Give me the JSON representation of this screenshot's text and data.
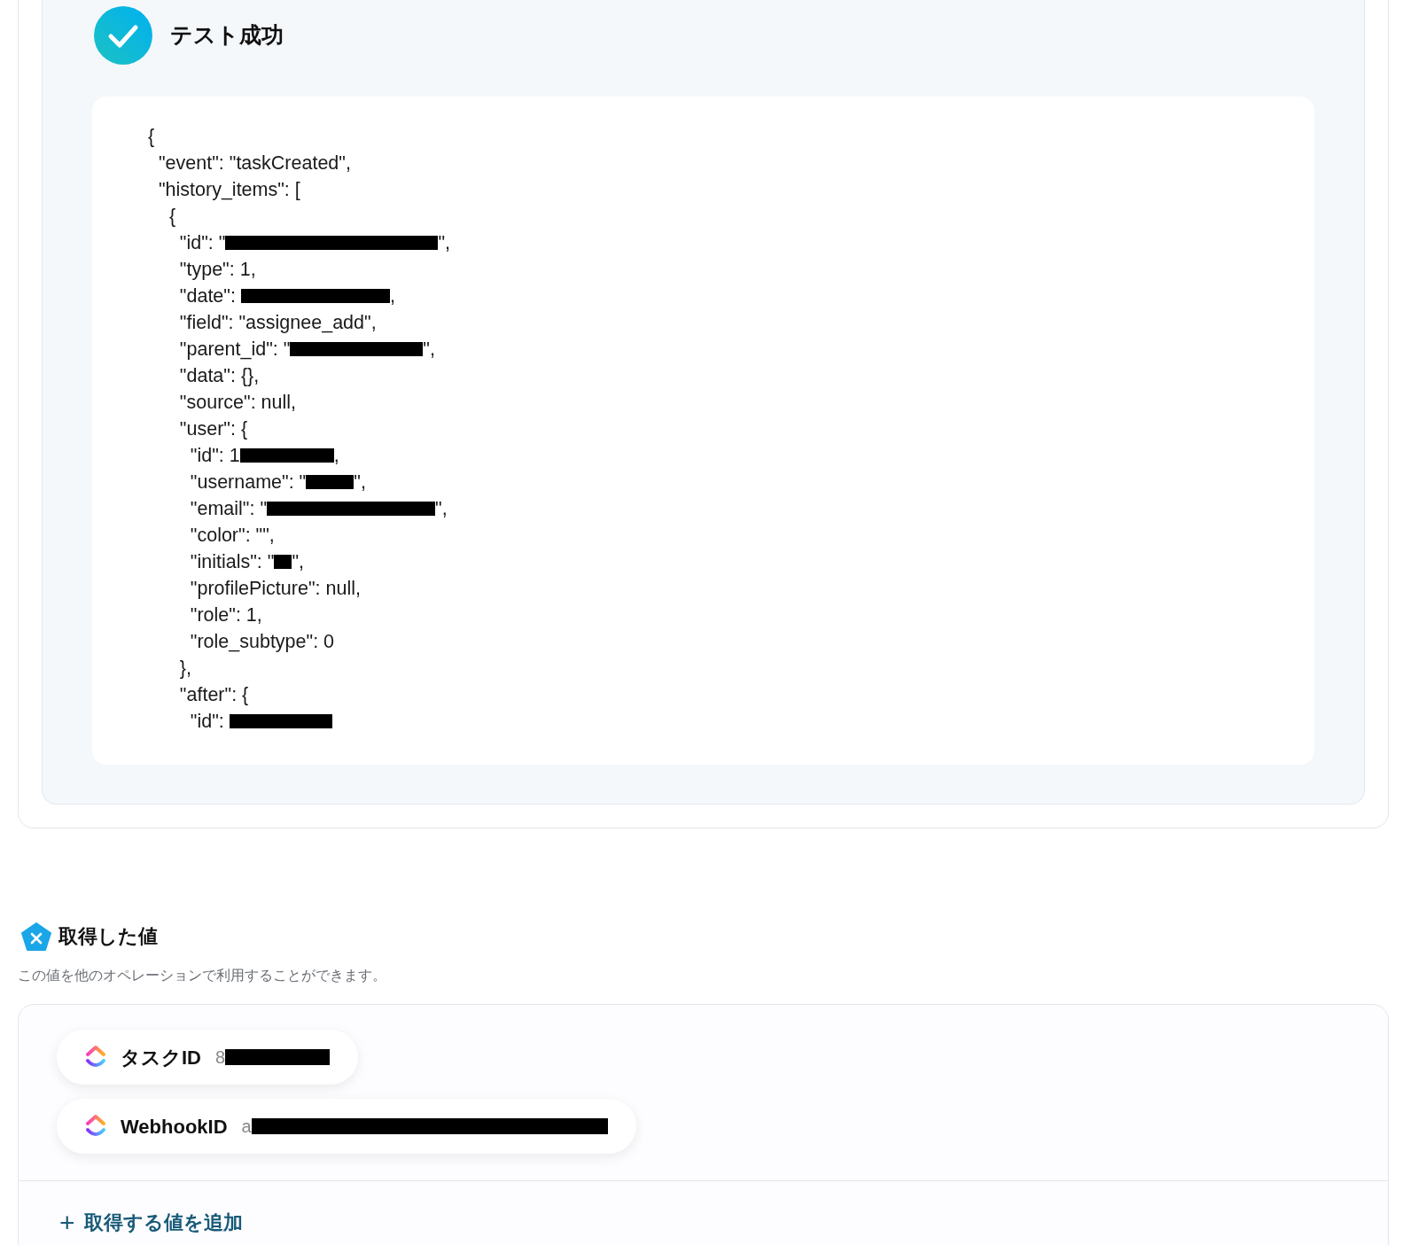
{
  "test_result": {
    "passed": true,
    "title": "テスト成功",
    "code_lines": [
      {
        "text": "{"
      },
      {
        "text": "  \"event\": \"taskCreated\","
      },
      {
        "text": "  \"history_items\": ["
      },
      {
        "text": "    {"
      },
      {
        "text": "      \"id\": \"",
        "redacted": true,
        "after": "\","
      },
      {
        "text": "      \"type\": 1,"
      },
      {
        "text": "      \"date\": ",
        "redacted": true,
        "after": ","
      },
      {
        "text": "      \"field\": \"assignee_add\","
      },
      {
        "text": "      \"parent_id\": \"",
        "redacted": true,
        "after": "\","
      },
      {
        "text": "      \"data\": {},"
      },
      {
        "text": "      \"source\": null,"
      },
      {
        "text": "      \"user\": {"
      },
      {
        "text": "        \"id\": 1",
        "redacted": true,
        "after": ","
      },
      {
        "text": "        \"username\": \"",
        "redacted": true,
        "after": "\","
      },
      {
        "text": "        \"email\": \"",
        "redacted": true,
        "after": "\","
      },
      {
        "text": "        \"color\": \"\","
      },
      {
        "text": "        \"initials\": \"",
        "redacted": true,
        "after": "\","
      },
      {
        "text": "        \"profilePicture\": null,"
      },
      {
        "text": "        \"role\": 1,"
      },
      {
        "text": "        \"role_subtype\": 0"
      },
      {
        "text": "      },"
      },
      {
        "text": "      \"after\": {"
      },
      {
        "text": "        \"id\": ",
        "redacted": true
      }
    ]
  },
  "values": {
    "title": "取得した値",
    "description": "この値を他のオペレーションで利用することができます。",
    "items": [
      {
        "label": "タスクID",
        "value_prefix": "8",
        "redacted": true
      },
      {
        "label": "WebhookID",
        "value_prefix": "a",
        "redacted": true
      }
    ],
    "add_link": {
      "icon": "+",
      "label": "取得する値を追加"
    }
  }
}
